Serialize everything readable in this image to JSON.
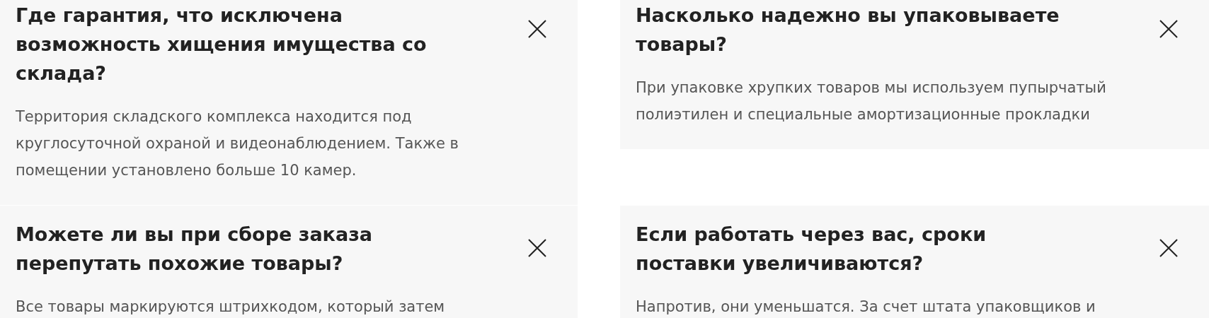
{
  "faq": [
    {
      "question": "Где гарантия, что исключена возможность хищения имущества со склада?",
      "answer": "Территория складского комплекса находится под круглосуточной охраной и видеонаблюдением. Также в помещении установлено больше 10 камер.",
      "expanded": true
    },
    {
      "question": "Насколько надежно вы упаковываете товары?",
      "answer": "При упаковке хрупких товаров мы используем пупырчатый полиэтилен и специальные амортизационные прокладки",
      "expanded": true
    },
    {
      "question": "Можете ли вы при сборе заказа перепутать похожие товары?",
      "answer": "Все товары маркируются штрихкодом, который затем",
      "expanded": true
    },
    {
      "question": "Если работать через вас, сроки поставки увеличиваются?",
      "answer": "Напротив, они уменьшатся. За счет штата упаковщиков и",
      "expanded": true
    }
  ]
}
